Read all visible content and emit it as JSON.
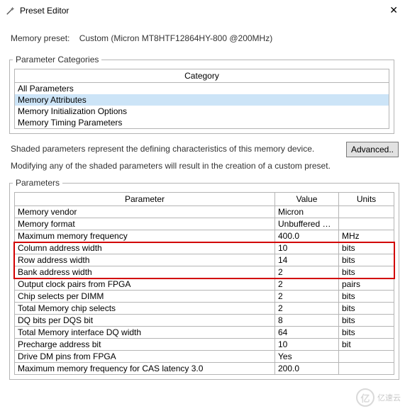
{
  "window": {
    "title": "Preset Editor"
  },
  "preset": {
    "label": "Memory preset:",
    "value": "Custom (Micron MT8HTF12864HY-800 @200MHz)"
  },
  "categories": {
    "legend": "Parameter Categories",
    "header": "Category",
    "items": [
      {
        "label": "All Parameters",
        "selected": false
      },
      {
        "label": "Memory Attributes",
        "selected": true
      },
      {
        "label": "Memory Initialization Options",
        "selected": false
      },
      {
        "label": "Memory Timing Parameters",
        "selected": false
      }
    ]
  },
  "info": {
    "line1": "Shaded parameters represent the defining characteristics of this memory device.",
    "line2": "Modifying any of the shaded parameters will result in the creation of a custom preset.",
    "advanced": "Advanced.."
  },
  "params": {
    "legend": "Parameters",
    "headers": {
      "param": "Parameter",
      "value": "Value",
      "units": "Units"
    },
    "rows": [
      {
        "name": "Memory vendor",
        "value": "Micron",
        "units": "",
        "hl": false
      },
      {
        "name": "Memory format",
        "value": "Unbuffered DI...",
        "units": "",
        "hl": false
      },
      {
        "name": "Maximum memory frequency",
        "value": "400.0",
        "units": "MHz",
        "hl": false
      },
      {
        "name": "Column address width",
        "value": "10",
        "units": "bits",
        "hl": true
      },
      {
        "name": "Row address width",
        "value": "14",
        "units": "bits",
        "hl": true
      },
      {
        "name": "Bank address width",
        "value": "2",
        "units": "bits",
        "hl": true
      },
      {
        "name": "Output clock pairs from FPGA",
        "value": "2",
        "units": "pairs",
        "hl": false
      },
      {
        "name": "Chip selects per DIMM",
        "value": "2",
        "units": "bits",
        "hl": false
      },
      {
        "name": "Total Memory chip selects",
        "value": "2",
        "units": "bits",
        "hl": false
      },
      {
        "name": "DQ bits per DQS bit",
        "value": "8",
        "units": "bits",
        "hl": false
      },
      {
        "name": "Total Memory interface DQ width",
        "value": "64",
        "units": "bits",
        "hl": false
      },
      {
        "name": "Precharge address bit",
        "value": "10",
        "units": "bit",
        "hl": false
      },
      {
        "name": "Drive DM pins from FPGA",
        "value": "Yes",
        "units": "",
        "hl": false
      },
      {
        "name": "Maximum memory frequency for CAS latency 3.0",
        "value": "200.0",
        "units": "",
        "hl": false
      }
    ]
  },
  "watermark": {
    "text": "亿速云"
  }
}
